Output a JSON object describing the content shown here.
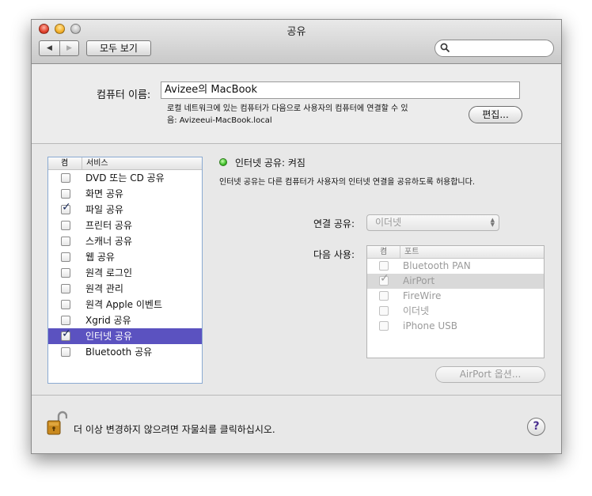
{
  "window": {
    "title": "공유"
  },
  "toolbar": {
    "back_label": "◀",
    "forward_label": "▶",
    "show_all_label": "모두 보기",
    "search_placeholder": ""
  },
  "computer_name": {
    "label": "컴퓨터 이름:",
    "value": "Avizee의 MacBook",
    "description_line1": "로컬 네트워크에 있는 컴퓨터가 다음으로 사용자의 컴퓨터에 연결할 수 있",
    "description_line2": "음: Avizeeui-MacBook.local",
    "edit_button": "편집..."
  },
  "services": {
    "header_on": "켬",
    "header_service": "서비스",
    "items": [
      {
        "label": "DVD 또는 CD 공유",
        "checked": false,
        "selected": false
      },
      {
        "label": "화면 공유",
        "checked": false,
        "selected": false
      },
      {
        "label": "파일 공유",
        "checked": true,
        "selected": false
      },
      {
        "label": "프린터 공유",
        "checked": false,
        "selected": false
      },
      {
        "label": "스캐너 공유",
        "checked": false,
        "selected": false
      },
      {
        "label": "웹 공유",
        "checked": false,
        "selected": false
      },
      {
        "label": "원격 로그인",
        "checked": false,
        "selected": false
      },
      {
        "label": "원격 관리",
        "checked": false,
        "selected": false
      },
      {
        "label": "원격 Apple 이벤트",
        "checked": false,
        "selected": false
      },
      {
        "label": "Xgrid 공유",
        "checked": false,
        "selected": false
      },
      {
        "label": "인터넷 공유",
        "checked": true,
        "selected": true
      },
      {
        "label": "Bluetooth 공유",
        "checked": false,
        "selected": false
      }
    ]
  },
  "detail": {
    "status": "인터넷 공유: 켜짐",
    "status_color": "#3fbf2a",
    "description": "인터넷 공유는 다른 컴퓨터가 사용자의 인터넷 연결을 공유하도록 허용합니다.",
    "share_from_label": "연결 공유:",
    "share_from_value": "이더넷",
    "to_computers_label": "다음 사용:",
    "ports_header_on": "켬",
    "ports_header_port": "포트",
    "ports": [
      {
        "label": "Bluetooth PAN",
        "checked": false,
        "highlighted": false
      },
      {
        "label": "AirPort",
        "checked": true,
        "highlighted": true
      },
      {
        "label": "FireWire",
        "checked": false,
        "highlighted": false
      },
      {
        "label": "이더넷",
        "checked": false,
        "highlighted": false
      },
      {
        "label": "iPhone USB",
        "checked": false,
        "highlighted": false
      }
    ],
    "airport_options_button": "AirPort 옵션..."
  },
  "footer": {
    "lock_text": "더 이상 변경하지 않으려면 자물쇠를 클릭하십시오.",
    "help_label": "?"
  }
}
